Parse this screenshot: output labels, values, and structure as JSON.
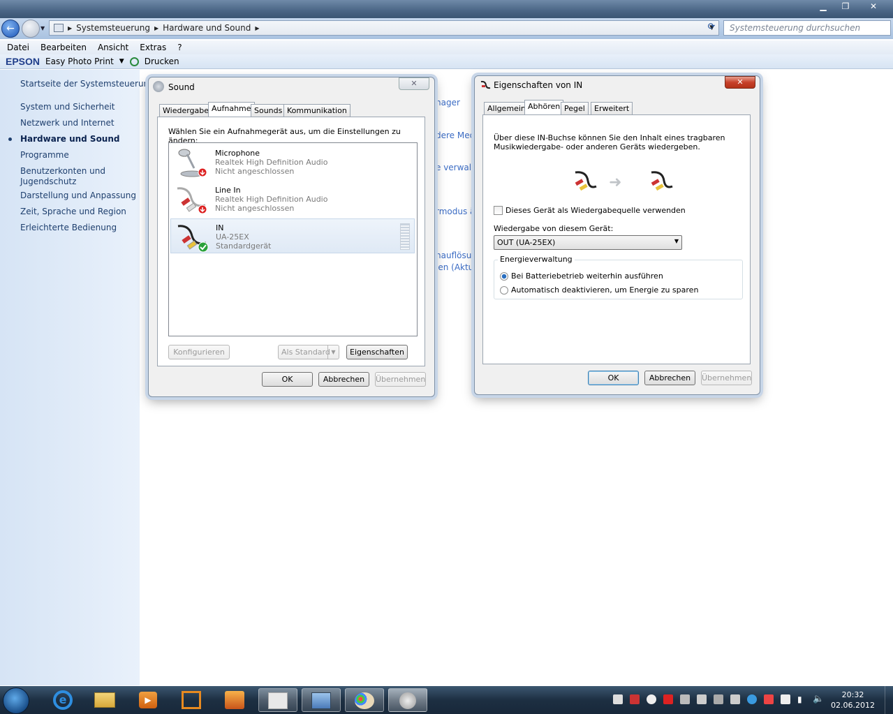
{
  "explorer": {
    "breadcrumb": [
      "Systemsteuerung",
      "Hardware und Sound"
    ],
    "search_placeholder": "Systemsteuerung durchsuchen",
    "menu": [
      "Datei",
      "Bearbeiten",
      "Ansicht",
      "Extras",
      "?"
    ],
    "toolbar": {
      "brand": "EPSON",
      "photo_print": "Easy Photo Print",
      "print": "Drucken"
    },
    "left_nav": {
      "home": "Startseite der Systemsteuerung",
      "items": [
        "System und Sicherheit",
        "Netzwerk und Internet",
        "Hardware und Sound",
        "Programme",
        "Benutzerkonten und Jugendschutz",
        "Darstellung und Anpassung",
        "Zeit, Sprache und Region",
        "Erleichterte Bedienung"
      ]
    },
    "background_links": [
      "nager",
      "dere Medi",
      "e verwalte",
      "rmodus ä",
      "hauflösung",
      "len (Aktua"
    ]
  },
  "sound_dialog": {
    "title": "Sound",
    "tabs": [
      "Wiedergabe",
      "Aufnahme",
      "Sounds",
      "Kommunikation"
    ],
    "instruction": "Wählen Sie ein Aufnahmegerät aus, um die Einstellungen zu ändern:",
    "devices": [
      {
        "name": "Microphone",
        "driver": "Realtek High Definition Audio",
        "status": "Nicht angeschlossen"
      },
      {
        "name": "Line In",
        "driver": "Realtek High Definition Audio",
        "status": "Nicht angeschlossen"
      },
      {
        "name": "IN",
        "driver": "UA-25EX",
        "status": "Standardgerät"
      }
    ],
    "buttons": {
      "configure": "Konfigurieren",
      "set_default": "Als Standard",
      "properties": "Eigenschaften",
      "ok": "OK",
      "cancel": "Abbrechen",
      "apply": "Übernehmen"
    }
  },
  "props_dialog": {
    "title": "Eigenschaften von IN",
    "tabs": [
      "Allgemein",
      "Abhören",
      "Pegel",
      "Erweitert"
    ],
    "description": "Über diese IN-Buchse können Sie den Inhalt eines tragbaren Musikwiedergabe- oder anderen Geräts wiedergeben.",
    "listen_checkbox": "Dieses Gerät als Wiedergabequelle verwenden",
    "playback_label": "Wiedergabe von diesem Gerät:",
    "playback_value": "OUT (UA-25EX)",
    "power_group": "Energieverwaltung",
    "power_options": [
      "Bei Batteriebetrieb weiterhin ausführen",
      "Automatisch deaktivieren, um Energie zu sparen"
    ],
    "buttons": {
      "ok": "OK",
      "cancel": "Abbrechen",
      "apply": "Übernehmen"
    }
  },
  "taskbar": {
    "time": "20:32",
    "date": "02.06.2012"
  }
}
